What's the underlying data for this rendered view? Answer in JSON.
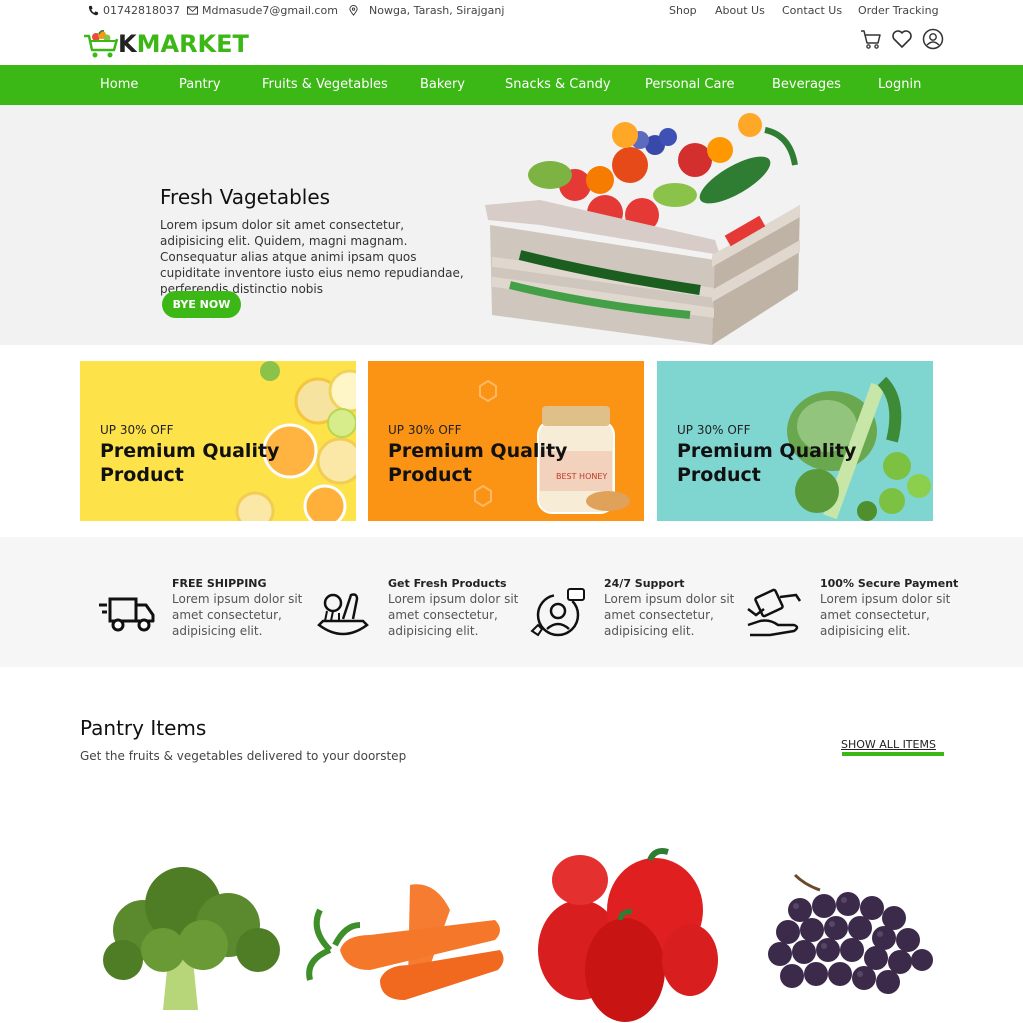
{
  "topbar": {
    "phone": "01742818037",
    "email": "Mdmasude7@gmail.com",
    "address": "Nowga, Tarash, Sirajganj",
    "links": [
      "Shop",
      "About Us",
      "Contact Us",
      "Order Tracking"
    ]
  },
  "logo": {
    "text_k": "K",
    "text_rest": "MARKET"
  },
  "header_icons": [
    "cart-icon",
    "heart-icon",
    "user-icon"
  ],
  "nav": [
    "Home",
    "Pantry",
    "Fruits & Vegetables",
    "Bakery",
    "Snacks & Candy",
    "Personal Care",
    "Beverages",
    "Lognin"
  ],
  "hero": {
    "title": "Fresh Vagetables",
    "text": "Lorem ipsum dolor sit amet consectetur, adipisicing elit. Quidem, magni magnam. Consequatur alias atque animi ipsam quos cupiditate inventore iusto eius nemo repudiandae, perferendis distinctio nobis",
    "button": "BYE NOW"
  },
  "promos": [
    {
      "off": "UP 30% OFF",
      "title": "Premium Quality Product",
      "bg": "#fde24a"
    },
    {
      "off": "UP 30% OFF",
      "title": "Premium Quality Product",
      "bg": "#fb9314"
    },
    {
      "off": "UP 30% OFF",
      "title": "Premium Quality Product",
      "bg": "#7fd6d1"
    }
  ],
  "features": [
    {
      "title": "FREE SHIPPING",
      "text": "Lorem ipsum dolor sit amet consectetur, adipisicing elit.",
      "icon": "truck-icon"
    },
    {
      "title": "Get Fresh Products",
      "text": "Lorem ipsum dolor sit amet consectetur, adipisicing elit.",
      "icon": "vegetables-basket-icon"
    },
    {
      "title": "24/7 Support",
      "text": "Lorem ipsum dolor sit amet consectetur, adipisicing elit.",
      "icon": "support-agent-icon"
    },
    {
      "title": "100% Secure Payment",
      "text": "Lorem ipsum dolor sit amet consectetur, adipisicing elit.",
      "icon": "secure-payment-icon"
    }
  ],
  "section": {
    "title": "Pantry Items",
    "subtitle": "Get the fruits & vegetables delivered to your doorstep",
    "show_all": "SHOW ALL ITEMS"
  },
  "products": [
    "broccoli",
    "carrots",
    "red-peppers",
    "grapes"
  ],
  "colors": {
    "accent": "#3cb816",
    "hero_bg": "#f2f2f2"
  }
}
